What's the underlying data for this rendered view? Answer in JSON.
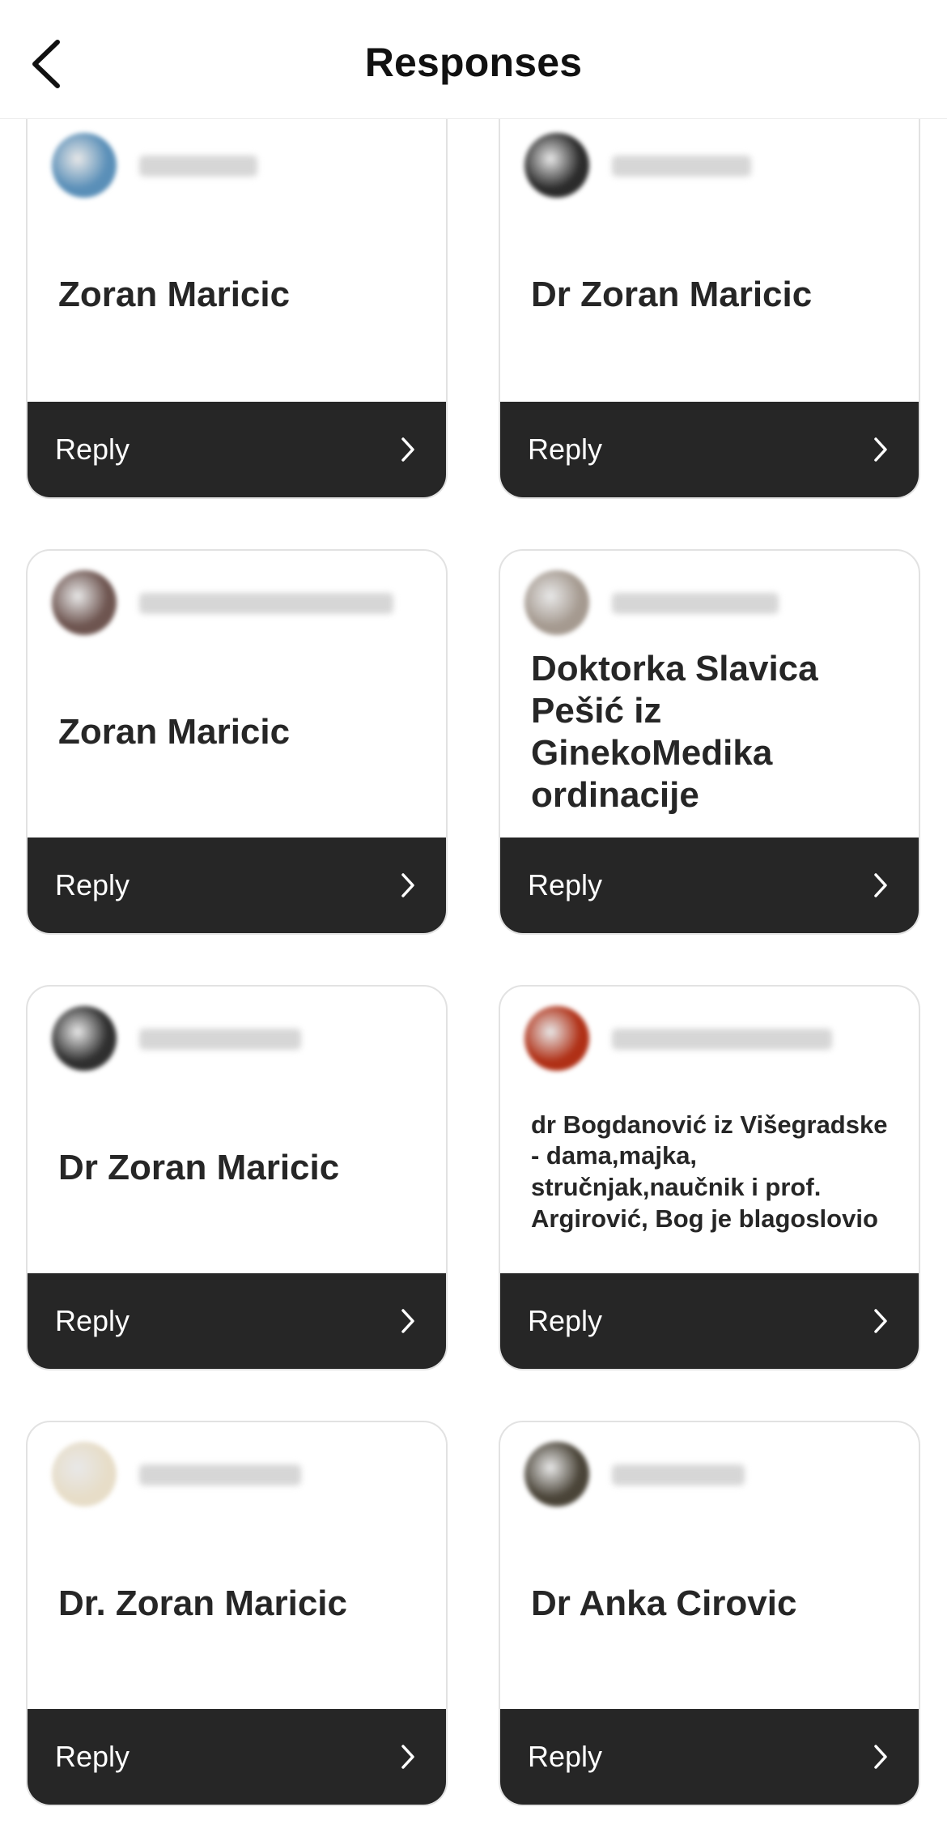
{
  "header": {
    "title": "Responses",
    "back_icon": "chevron-left-icon"
  },
  "cards": [
    {
      "response": "Zoran Maricic",
      "reply_label": "Reply",
      "avatar_color": "#5a8fb8",
      "small": false
    },
    {
      "response": "Dr Zoran Maricic",
      "reply_label": "Reply",
      "avatar_color": "#2b2b2b",
      "small": false
    },
    {
      "response": "Zoran Maricic",
      "reply_label": "Reply",
      "avatar_color": "#6e5550",
      "small": false
    },
    {
      "response": "Doktorka Slavica Pešić iz GinekoMedika ordinacije",
      "reply_label": "Reply",
      "avatar_color": "#a59a90",
      "small": false
    },
    {
      "response": "Dr Zoran Maricic",
      "reply_label": "Reply",
      "avatar_color": "#2f2f2f",
      "small": false
    },
    {
      "response": "dr Bogdanović iz Višegradske - dama,majka, stručnjak,naučnik i prof. Argirović, Bog je blagoslovio",
      "reply_label": "Reply",
      "avatar_color": "#b03016",
      "small": true
    },
    {
      "response": "Dr. Zoran Maricic",
      "reply_label": "Reply",
      "avatar_color": "#e7ddc8",
      "small": false
    },
    {
      "response": "Dr Anka Cirovic",
      "reply_label": "Reply",
      "avatar_color": "#4a4438",
      "small": false
    }
  ]
}
